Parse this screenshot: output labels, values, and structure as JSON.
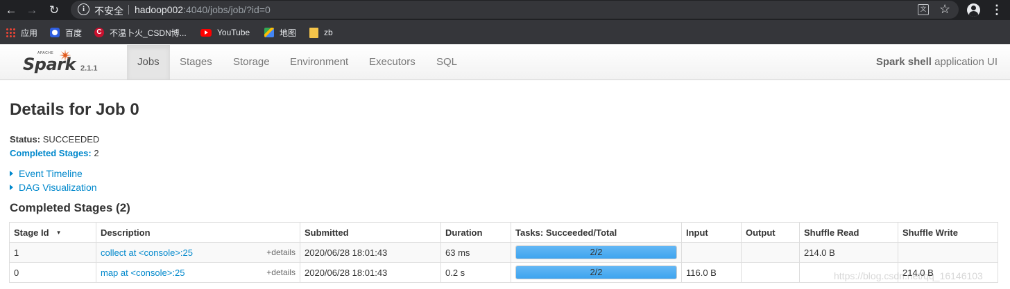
{
  "browser": {
    "insecure_label": "不安全",
    "url_host": "hadoop002",
    "url_rest": ":4040/jobs/job/?id=0",
    "back_glyph": "←",
    "forward_glyph": "→",
    "reload_glyph": "↻",
    "star_glyph": "☆",
    "menu_glyph": "⋮"
  },
  "bookmarks": [
    {
      "label": "应用",
      "icon": "apps-icon"
    },
    {
      "label": "百度",
      "icon": "baidu-icon"
    },
    {
      "label": "不温卜火_CSDN博...",
      "icon": "csdn-icon"
    },
    {
      "label": "YouTube",
      "icon": "youtube-icon"
    },
    {
      "label": "地图",
      "icon": "maps-icon"
    },
    {
      "label": "zb",
      "icon": "folder-icon"
    }
  ],
  "spark": {
    "logo_apache": "APACHE",
    "logo_word": "Spark",
    "version": "2.1.1",
    "tabs": [
      "Jobs",
      "Stages",
      "Storage",
      "Environment",
      "Executors",
      "SQL"
    ],
    "active_tab": "Jobs",
    "app_name_bold": "Spark shell",
    "app_name_rest": " application UI"
  },
  "job": {
    "title": "Details for Job 0",
    "status_label": "Status:",
    "status_value": "SUCCEEDED",
    "completed_label": "Completed Stages:",
    "completed_value": "2",
    "toggles": [
      "Event Timeline",
      "DAG Visualization"
    ],
    "section_title": "Completed Stages (2)"
  },
  "stages_table": {
    "headers": [
      "Stage Id",
      "Description",
      "Submitted",
      "Duration",
      "Tasks: Succeeded/Total",
      "Input",
      "Output",
      "Shuffle Read",
      "Shuffle Write"
    ],
    "sort_glyph": "▼",
    "rows": [
      {
        "stage_id": "1",
        "description": "collect at <console>:25",
        "details": "+details",
        "submitted": "2020/06/28 18:01:43",
        "duration": "63 ms",
        "tasks_text": "2/2",
        "tasks_fraction": 1.0,
        "input": "",
        "output": "",
        "shuffle_read": "214.0 B",
        "shuffle_write": ""
      },
      {
        "stage_id": "0",
        "description": "map at <console>:25",
        "details": "+details",
        "submitted": "2020/06/28 18:01:43",
        "duration": "0.2 s",
        "tasks_text": "2/2",
        "tasks_fraction": 1.0,
        "input": "116.0 B",
        "output": "",
        "shuffle_read": "",
        "shuffle_write": "214.0 B"
      }
    ]
  },
  "watermark": "https://blog.csdn.net/qq_16146103"
}
